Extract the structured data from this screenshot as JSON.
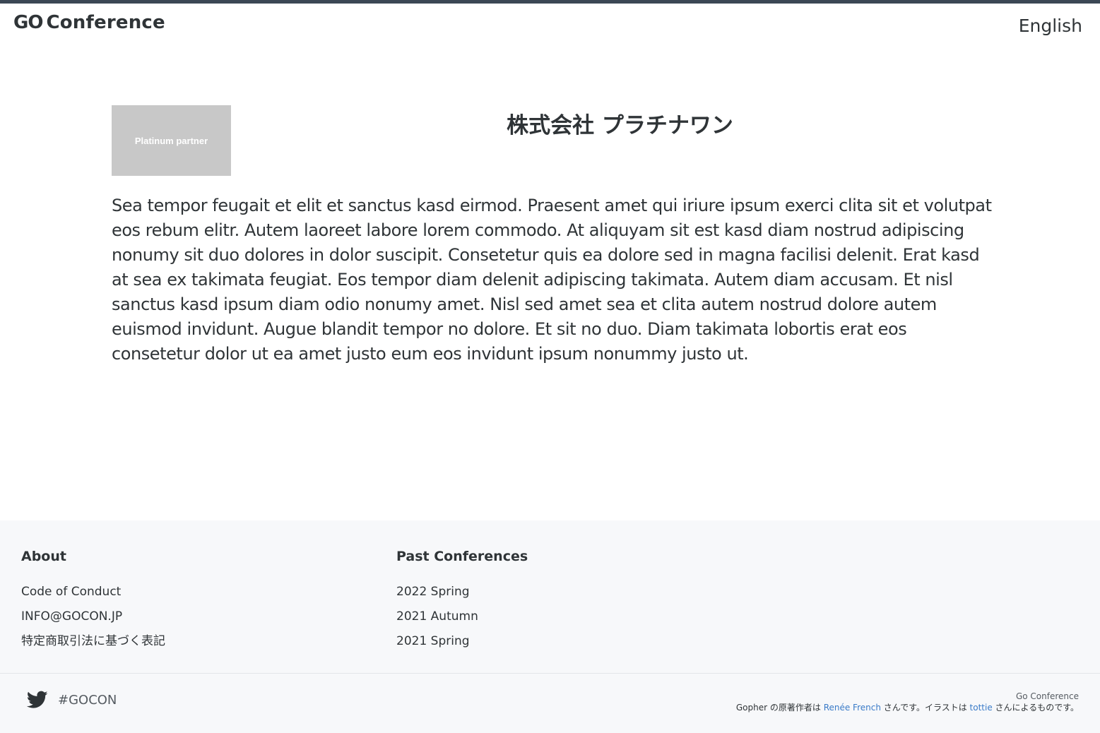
{
  "header": {
    "logo_go": "GO",
    "logo_text": "Conference",
    "language": "English"
  },
  "partner": {
    "logo_label": "Platinum partner",
    "name": "株式会社 プラチナワン",
    "description": "Sea tempor feugait et elit et sanctus kasd eirmod. Praesent amet qui iriure ipsum exerci clita sit et volutpat eos rebum elitr. Autem laoreet labore lorem commodo. At aliquyam sit est kasd diam nostrud adipiscing nonumy sit duo dolores in dolor suscipit. Consetetur quis ea dolore sed in magna facilisi delenit. Erat kasd at sea ex takimata feugiat. Eos tempor diam delenit adipiscing takimata. Autem diam accusam. Et nisl sanctus kasd ipsum diam odio nonumy amet. Nisl sed amet sea et clita autem nostrud dolore autem euismod invidunt. Augue blandit tempor no dolore. Et sit no duo. Diam takimata lobortis erat eos consetetur dolor ut ea amet justo eum eos invidunt ipsum nonummy justo ut."
  },
  "footer": {
    "about": {
      "heading": "About",
      "links": [
        "Code of Conduct",
        "INFO@GOCON.JP",
        "特定商取引法に基づく表記"
      ]
    },
    "past": {
      "heading": "Past Conferences",
      "links": [
        "2022 Spring",
        "2021 Autumn",
        "2021 Spring"
      ]
    },
    "social": {
      "icon": "twitter-icon",
      "hashtag": "#GOCON"
    },
    "credits": {
      "conf_name": "Go Conference",
      "line_prefix": "Gopher の原著作者は ",
      "author_link": "Renée French",
      "line_middle": " さんです。イラストは ",
      "illustrator_link": "tottie",
      "line_suffix": " さんによるものです。"
    }
  }
}
